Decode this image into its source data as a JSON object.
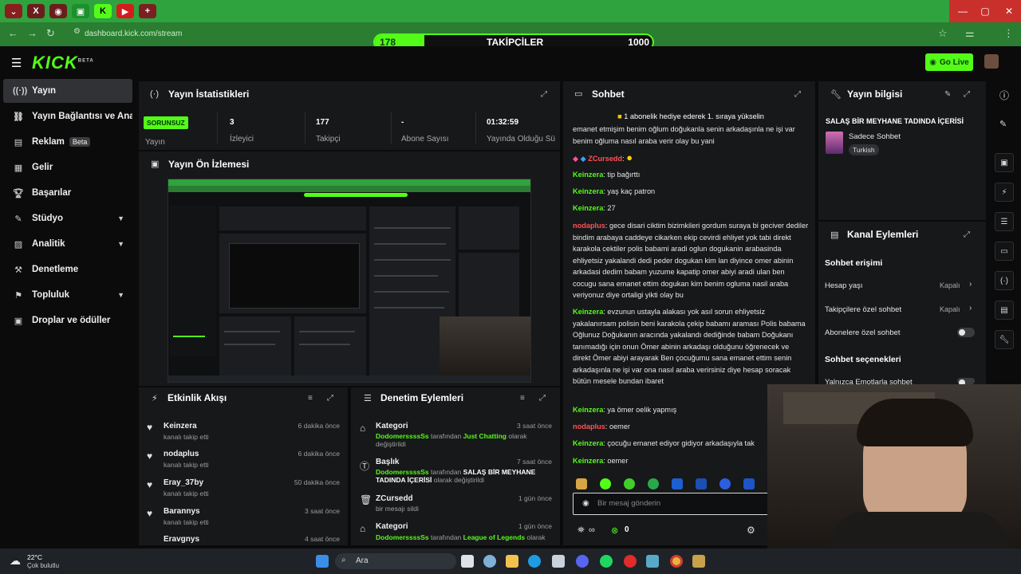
{
  "browser": {
    "url": "dashboard.kick.com/stream",
    "followers_bar": {
      "label": "TAKİPÇİLER",
      "current": "178",
      "goal": "1000",
      "fraction": 0.178
    }
  },
  "header": {
    "logo": "KICK",
    "logo_sup": "BETA",
    "go_live": "Go Live"
  },
  "sidebar": {
    "items": [
      {
        "label": "Yayın"
      },
      {
        "label": "Yayın Bağlantısı ve Anahtar"
      },
      {
        "label": "Reklam",
        "badge": "Beta"
      },
      {
        "label": "Gelir"
      },
      {
        "label": "Başarılar"
      },
      {
        "label": "Stüdyo"
      },
      {
        "label": "Analitik"
      },
      {
        "label": "Denetleme"
      },
      {
        "label": "Topluluk"
      },
      {
        "label": "Droplar ve ödüller"
      }
    ]
  },
  "stats": {
    "title": "Yayın İstatistikleri",
    "badge": "SORUNSUZ",
    "badge_label": "Yayın",
    "items": [
      {
        "value": "3",
        "label": "İzleyici"
      },
      {
        "value": "177",
        "label": "Takipçi"
      },
      {
        "value": "-",
        "label": "Abone Sayısı"
      },
      {
        "value": "01:32:59",
        "label": "Yayında Olduğu Süre"
      }
    ]
  },
  "preview": {
    "title": "Yayın Ön İzlemesi"
  },
  "activity": {
    "title": "Etkinlik Akışı",
    "items": [
      {
        "name": "Keinzera",
        "sub": "kanalı takip etti",
        "time": "6 dakika önce"
      },
      {
        "name": "nodaplus",
        "sub": "kanalı takip etti",
        "time": "6 dakika önce"
      },
      {
        "name": "Eray_37by",
        "sub": "kanalı takip etti",
        "time": "50 dakika önce"
      },
      {
        "name": "Barannys",
        "sub": "kanalı takip etti",
        "time": "3 saat önce"
      },
      {
        "name": "Eravgnys",
        "sub": "",
        "time": "4 saat önce"
      }
    ]
  },
  "moderation": {
    "title": "Denetim Eylemleri",
    "items": [
      {
        "title": "Kategori",
        "time": "3 saat önce",
        "user": "DodomerssssSs",
        "pre": "tarafından",
        "target": "Just Chatting",
        "post": "olarak değiştirildi"
      },
      {
        "title": "Başlık",
        "time": "7 saat önce",
        "user": "DodomerssssSs",
        "pre": "tarafından",
        "target": "SALAŞ BİR MEYHANE TADINDA İÇERİSİ",
        "post": "olarak değiştirildi"
      },
      {
        "title": "ZCursedd",
        "time": "1 gün önce",
        "user": "",
        "pre": "bir mesajı sildi",
        "target": "",
        "post": ""
      },
      {
        "title": "Kategori",
        "time": "1 gün önce",
        "user": "DodomerssssSs",
        "pre": "tarafından",
        "target": "League of Legends",
        "post": "olarak"
      }
    ]
  },
  "chat": {
    "title": "Sohbet",
    "pinned": "1 abonelik hediye ederek 1. sıraya yükselin",
    "messages": [
      {
        "name": "",
        "color": "#ffffff",
        "text": "emanet etmişim benim oğlum doğukanla senin arkadaşınla ne işi var benim oğluma nasıl araba verir olay bu yani"
      },
      {
        "name": "ZCursedd",
        "color": "#ff5252",
        "text": ""
      },
      {
        "name": "Keinzera",
        "color": "#53fc18",
        "text": "tip bağırttı"
      },
      {
        "name": "Keinzera",
        "color": "#53fc18",
        "text": "yaş kaç patron"
      },
      {
        "name": "Keinzera",
        "color": "#53fc18",
        "text": "27"
      },
      {
        "name": "nodaplus",
        "color": "#ff5252",
        "text": "gece disari ciktim bizimkileri gordum suraya bi geciver dediler bindim arabaya caddeye cikarken ekip cevirdi ehliyet yok tabi direkt karakola cektiler polis babami aradi oglun dogukanin arabasinda ehliyetsiz yakalandi dedi peder dogukan kim lan diyince omer abinin arkadasi dedim babam yuzume kapatip omer abiyi aradi ulan ben cocugu sana emanet ettim dogukan kim benim ogluma nasil araba veriyonuz diye ortaligi yikti olay bu"
      },
      {
        "name": "Keinzera",
        "color": "#53fc18",
        "text": "evzunun ustayla alakası yok asıl sorun ehliyetsiz yakalanırsam polisin beni karakola çekip babamı araması Polis babama Oğlunuz Doğukanın aracında yakalandı dediğinde babam Doğukanı tanımadığı için onun Ömer abinin arkadaşı olduğunu öğrenecek ve direkt Ömer abiyi arayarak Ben çocuğumu sana emanet ettim senin arkadaşınla ne işi var ona nasıl araba verirsiniz diye hesap soracak bütün mesele bundan ibaret"
      },
      {
        "name": "Keinzera",
        "color": "#53fc18",
        "text": "ya ömer oelik yapmış"
      },
      {
        "name": "nodaplus",
        "color": "#ff5252",
        "text": "oemer"
      },
      {
        "name": "Keinzera",
        "color": "#53fc18",
        "text": "çocuğu emanet ediyor gidiyor arkadaşıyla tak"
      },
      {
        "name": "Keinzera",
        "color": "#53fc18",
        "text": "oemer"
      }
    ],
    "input_placeholder": "Bir mesaj gönderin",
    "points": "0"
  },
  "stream_info": {
    "title": "Yayın bilgisi",
    "stream_title": "SALAŞ BİR MEYHANE TADINDA İÇERİSİ",
    "category": "Sadece Sohbet",
    "language": "Turkish"
  },
  "channel_actions": {
    "title": "Kanal Eylemleri",
    "section1": "Sohbet erişimi",
    "rows": [
      {
        "label": "Hesap yaşı",
        "value": "Kapalı"
      },
      {
        "label": "Takipçilere özel sohbet",
        "value": "Kapalı"
      },
      {
        "label": "Abonelere özel sohbet",
        "value": ""
      }
    ],
    "section2": "Sohbet seçenekleri",
    "row_partial": "Yalnızca Emotlarla sohbet"
  },
  "taskbar": {
    "temp": "22°C",
    "weather": "Çok bulutlu",
    "search": "Ara"
  },
  "colors": {
    "kick_green": "#53fc18",
    "panel": "#17181a",
    "bg": "#0b0b0c",
    "alert_red": "#ff5252"
  }
}
